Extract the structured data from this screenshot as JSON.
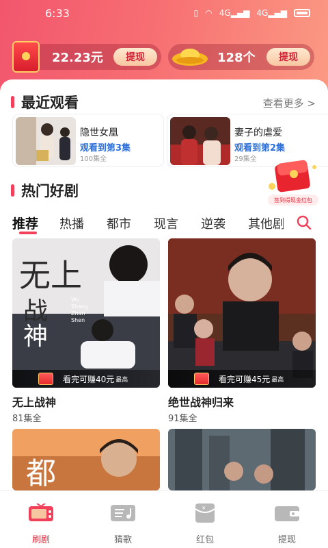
{
  "status_bar": {
    "time": "6:33",
    "signal_1": "4G",
    "signal_2": "4G"
  },
  "wallet": {
    "cash_value": "22.23元",
    "cash_withdraw": "提现",
    "coin_value": "128个",
    "coin_withdraw": "提现"
  },
  "recent": {
    "title": "最近观看",
    "see_more": "查看更多 >",
    "items": [
      {
        "name": "隐世女凰",
        "progress": "观看到第3集",
        "episodes": "100集全"
      },
      {
        "name": "妻子的虐爱",
        "progress": "观看到第2集",
        "episodes": "29集全"
      }
    ]
  },
  "promo": {
    "label": "签到得现金红包"
  },
  "hot": {
    "title": "热门好剧",
    "tabs": [
      "推荐",
      "热播",
      "都市",
      "现言",
      "逆袭",
      "其他剧"
    ],
    "dramas": [
      {
        "title": "无上战神",
        "episodes": "81集全",
        "reward": "看完可赚40元",
        "reward_sub": "最高"
      },
      {
        "title": "绝世战神归来",
        "episodes": "91集全",
        "reward": "看完可赚45元",
        "reward_sub": "最高"
      },
      {
        "title": "",
        "episodes": ""
      },
      {
        "title": "",
        "episodes": ""
      }
    ],
    "poster_text": {
      "big_chars": "无上战神",
      "pinyin": "Wu Shang Zhan Shen",
      "partial": "都"
    }
  },
  "nav": {
    "items": [
      {
        "label": "刷剧",
        "icon": "tv-icon"
      },
      {
        "label": "猜歌",
        "icon": "music-icon"
      },
      {
        "label": "红包",
        "icon": "red-envelope-icon"
      },
      {
        "label": "提现",
        "icon": "wallet-icon"
      }
    ]
  },
  "colors": {
    "accent": "#f2405a",
    "gradient_start": "#f2566d",
    "gradient_end": "#fb9a83",
    "link_blue": "#2f6fd8"
  }
}
